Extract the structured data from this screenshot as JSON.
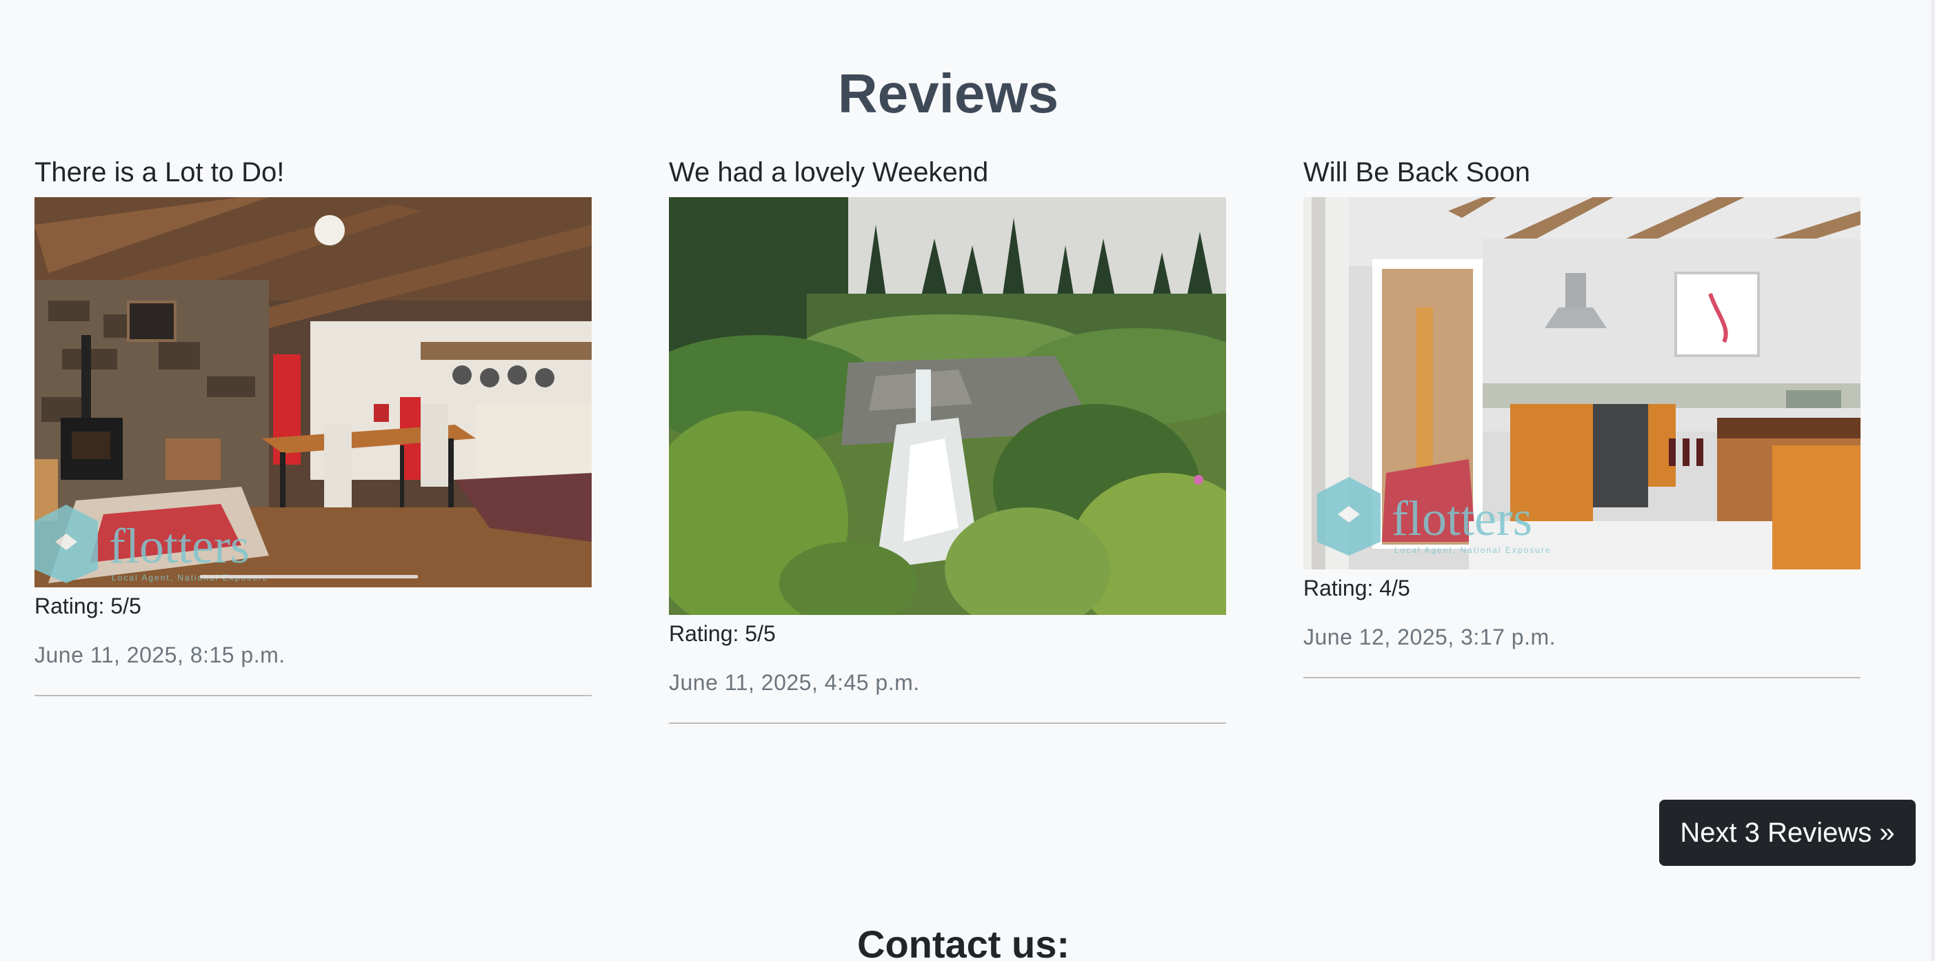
{
  "reviews": {
    "title": "Reviews",
    "items": [
      {
        "title": "There is a Lot to Do!",
        "rating": "Rating: 5/5",
        "date": "June 11, 2025, 8:15 p.m.",
        "image": "cottage-living-room-photo",
        "watermark_text": "flotters",
        "watermark_tagline": "Local Agent, National Exposure"
      },
      {
        "title": "We had a lovely Weekend",
        "rating": "Rating: 5/5",
        "date": "June 11, 2025, 4:45 p.m.",
        "image": "forest-waterfall-photo"
      },
      {
        "title": "Will Be Back Soon",
        "rating": "Rating: 4/5",
        "date": "June 12, 2025, 3:17 p.m.",
        "image": "cottage-kitchen-photo",
        "watermark_text": "flotters",
        "watermark_tagline": "Local Agent, National Exposure"
      }
    ],
    "next_button_label": "Next 3 Reviews »"
  },
  "contact": {
    "title": "Contact us:"
  },
  "colors": {
    "background": "#f8f9fb",
    "heading": "#3f4a58",
    "button_bg": "#212529",
    "date_text": "#6c757d",
    "watermark": "#7fc6cf"
  }
}
